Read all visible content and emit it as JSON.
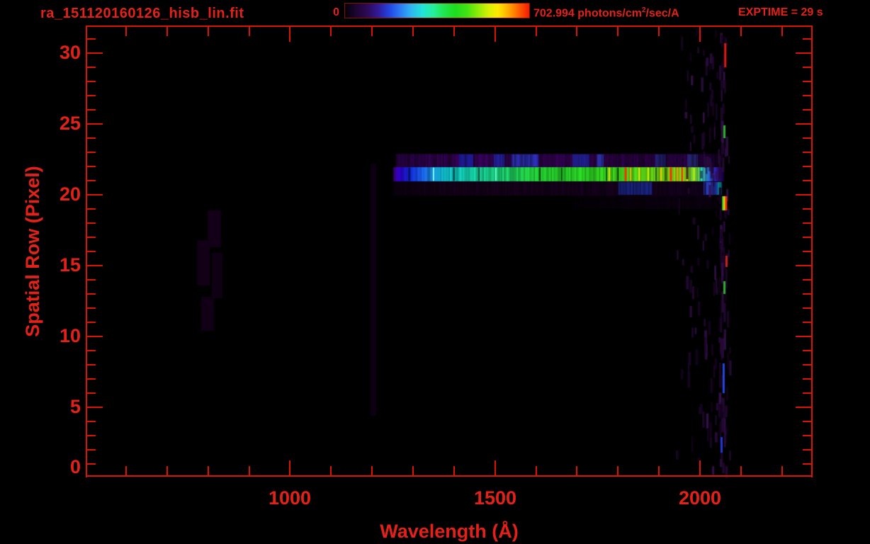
{
  "header": {
    "title": "ra_151120160126_hisb_lin.fit",
    "colorbar_min_label": "0",
    "flux_label_prefix": "702.994 photons/cm",
    "flux_label_sup": "2",
    "flux_label_suffix": "/sec/A",
    "exptime_label": "EXPTIME = 29 s"
  },
  "colors": {
    "text_red": "#e42118",
    "axis_red": "#da1404",
    "background": "#000000"
  },
  "chart_data": {
    "type": "heatmap",
    "title": "ra_151120160126_hisb_lin.fit",
    "xlabel": "Wavelength (Å)",
    "ylabel": "Spatial Row (Pixel)",
    "x_range": [
      503,
      2275
    ],
    "y_range": [
      0,
      31.8
    ],
    "x_major_ticks": [
      1000,
      1500,
      2000
    ],
    "x_minor_step": 100,
    "x_minor_first": 600,
    "x_minor_last": 2200,
    "y_major_ticks": [
      0,
      5,
      10,
      15,
      20,
      25,
      30
    ],
    "y_minor_step": 1,
    "grid": false,
    "colorbar": {
      "min": 0,
      "max": 702.994,
      "units": "photons/cm^2/sec/A",
      "gradient": [
        [
          0,
          "#050008"
        ],
        [
          0.06,
          "#1c0630"
        ],
        [
          0.12,
          "#2c0a54"
        ],
        [
          0.18,
          "#321a9a"
        ],
        [
          0.24,
          "#2244e0"
        ],
        [
          0.3,
          "#2b7bf4"
        ],
        [
          0.36,
          "#2fb6f0"
        ],
        [
          0.42,
          "#22e3d8"
        ],
        [
          0.48,
          "#25ef9a"
        ],
        [
          0.54,
          "#1fe64b"
        ],
        [
          0.6,
          "#1ddd1d"
        ],
        [
          0.66,
          "#3fe312"
        ],
        [
          0.72,
          "#8aec08"
        ],
        [
          0.78,
          "#d8f004"
        ],
        [
          0.83,
          "#fee800"
        ],
        [
          0.88,
          "#ffb400"
        ],
        [
          0.93,
          "#ff7000"
        ],
        [
          1,
          "#f51a02"
        ]
      ]
    },
    "exptime_s": 29,
    "trace": {
      "bands": [
        {
          "name": "row-19-faint",
          "rows": [
            19.0,
            19.95
          ],
          "lambda": [
            1690,
            2056
          ],
          "alphaStripe": 0.5,
          "stops": [
            [
              0,
              "#050007"
            ],
            [
              0.5,
              "#0b0010"
            ],
            [
              0.9,
              "#0e0014"
            ],
            [
              1,
              "#060008"
            ]
          ]
        },
        {
          "name": "row-20-lower",
          "rows": [
            19.95,
            20.95
          ],
          "lambda": [
            1252,
            2057
          ],
          "alphaStripe": 0.5,
          "stops": [
            [
              0,
              "#0d0011"
            ],
            [
              0.15,
              "#16001c"
            ],
            [
              0.5,
              "#190220"
            ],
            [
              0.8,
              "#17031f"
            ],
            [
              0.94,
              "#140120"
            ],
            [
              1,
              "#0a0010"
            ]
          ]
        },
        {
          "name": "row-21-main",
          "rows": [
            20.95,
            21.95
          ],
          "lambda": [
            1252,
            2059
          ],
          "alphaStripe": 0.32,
          "stops": [
            [
              0,
              "#4a0090"
            ],
            [
              0.02,
              "#3000d8"
            ],
            [
              0.05,
              "#1430f8"
            ],
            [
              0.1,
              "#1e7cf8"
            ],
            [
              0.15,
              "#12cfe4"
            ],
            [
              0.22,
              "#16e4c2"
            ],
            [
              0.3,
              "#1ce690"
            ],
            [
              0.38,
              "#24e258"
            ],
            [
              0.45,
              "#28de34"
            ],
            [
              0.6,
              "#30e424"
            ],
            [
              0.72,
              "#52e81c"
            ],
            [
              0.82,
              "#7eea14"
            ],
            [
              0.88,
              "#9ae412"
            ],
            [
              0.925,
              "#62d855"
            ],
            [
              0.945,
              "#2f9ad8"
            ],
            [
              0.96,
              "#2b55e8"
            ],
            [
              0.975,
              "#3518b0"
            ],
            [
              0.99,
              "#280668"
            ],
            [
              1,
              "#12002a"
            ]
          ]
        },
        {
          "name": "row-22-upper",
          "rows": [
            21.95,
            22.88
          ],
          "lambda": [
            1258,
            2052
          ],
          "alphaStripe": 0.5,
          "stops": [
            [
              0,
              "#26013f"
            ],
            [
              0.1,
              "#330156"
            ],
            [
              0.3,
              "#3a0260"
            ],
            [
              0.5,
              "#360259"
            ],
            [
              0.7,
              "#32024f"
            ],
            [
              0.9,
              "#2b0247"
            ],
            [
              0.97,
              "#1c0133"
            ],
            [
              1,
              "#0e0018"
            ]
          ]
        }
      ],
      "patches": [
        {
          "rows": [
            21.98,
            22.86
          ],
          "lambda": [
            1412,
            1447
          ],
          "color": "#2222b6"
        },
        {
          "rows": [
            21.98,
            22.86
          ],
          "lambda": [
            1497,
            1523
          ],
          "color": "#2a2cc4"
        },
        {
          "rows": [
            21.98,
            22.86
          ],
          "lambda": [
            1540,
            1606
          ],
          "color": "#3136cc"
        },
        {
          "rows": [
            21.98,
            22.86
          ],
          "lambda": [
            1689,
            1730
          ],
          "color": "#282ab8"
        },
        {
          "rows": [
            21.98,
            22.86
          ],
          "lambda": [
            1749,
            1765
          ],
          "color": "#3340cc"
        },
        {
          "rows": [
            21.98,
            22.86
          ],
          "lambda": [
            1891,
            1917
          ],
          "color": "#26267e"
        },
        {
          "rows": [
            21.98,
            22.86
          ],
          "lambda": [
            1969,
            1995
          ],
          "color": "#2c2c86"
        },
        {
          "rows": [
            20.0,
            20.9
          ],
          "lambda": [
            1801,
            1883
          ],
          "color": "#1e2a96"
        },
        {
          "rows": [
            20.0,
            20.9
          ],
          "lambda": [
            2009,
            2043
          ],
          "color": "#2d49e8"
        },
        {
          "rows": [
            20.0,
            20.9
          ],
          "lambda": [
            2043,
            2053
          ],
          "color": "#00b4c4"
        }
      ],
      "bright_lines_row": [
        20.98,
        21.92
      ],
      "bright_lines": [
        {
          "lambda": 1350,
          "color": "#7dffff",
          "w": 2
        },
        {
          "lambda": 1502,
          "color": "#5fffd0",
          "w": 2
        },
        {
          "lambda": 1779,
          "color": "#ffd000",
          "w": 2
        },
        {
          "lambda": 1819,
          "color": "#ff3000",
          "w": 3
        },
        {
          "lambda": 1831,
          "color": "#ffb000",
          "w": 2
        },
        {
          "lambda": 1852,
          "color": "#ffe000",
          "w": 2
        },
        {
          "lambda": 1874,
          "color": "#d8f000",
          "w": 2
        },
        {
          "lambda": 1905,
          "color": "#ffc800",
          "w": 2
        },
        {
          "lambda": 1929,
          "color": "#ff2800",
          "w": 3
        },
        {
          "lambda": 1945,
          "color": "#ff9800",
          "w": 2
        },
        {
          "lambda": 1957,
          "color": "#ff3000",
          "w": 2
        },
        {
          "lambda": 1969,
          "color": "#ffd800",
          "w": 2
        },
        {
          "lambda": 1986,
          "color": "#c8f000",
          "w": 2
        },
        {
          "lambda": 2004,
          "color": "#00e8ff",
          "w": 2
        }
      ],
      "dark_lines": [
        {
          "lambda": 1291,
          "w": 3
        },
        {
          "lambda": 1400,
          "w": 3
        },
        {
          "lambda": 1461,
          "w": 2
        },
        {
          "lambda": 1609,
          "w": 3
        },
        {
          "lambda": 1663,
          "w": 2
        },
        {
          "lambda": 1772,
          "w": 2
        },
        {
          "lambda": 1800,
          "w": 3
        },
        {
          "lambda": 1893,
          "w": 2
        },
        {
          "lambda": 1917,
          "w": 3
        }
      ],
      "specks": [
        {
          "lambda": 2061,
          "rows": [
            29.0,
            30.7
          ],
          "color": "#dc1810"
        },
        {
          "lambda": 2059,
          "rows": [
            24.0,
            24.9
          ],
          "color": "#28b428"
        },
        {
          "lambda": 2064,
          "rows": [
            14.9,
            15.7
          ],
          "color": "#c42418"
        },
        {
          "lambda": 2059,
          "rows": [
            13.0,
            13.9
          ],
          "color": "#2eae2e"
        },
        {
          "lambda": 2057,
          "rows": [
            6.0,
            8.1
          ],
          "color": "#2545de"
        },
        {
          "lambda": 2052,
          "rows": [
            1.8,
            2.9
          ],
          "color": "#2038d0"
        },
        {
          "lambda": 2056,
          "rows": [
            18.9,
            19.9
          ],
          "color": "#58d820"
        },
        {
          "lambda": 2060,
          "rows": [
            18.9,
            19.9
          ],
          "color": "#f0d800"
        },
        {
          "lambda": 2063,
          "rows": [
            18.9,
            19.9
          ],
          "color": "#e83010"
        }
      ],
      "artifacts": [
        {
          "lambda": [
            1196,
            1210
          ],
          "rows": [
            4.4,
            22.2
          ],
          "color": "#0c0012"
        },
        {
          "lambda": [
            799,
            831
          ],
          "rows": [
            16.3,
            18.9
          ],
          "color": "#130018"
        },
        {
          "lambda": [
            773,
            804
          ],
          "rows": [
            13.6,
            16.8
          ],
          "color": "#110016"
        },
        {
          "lambda": [
            809,
            835
          ],
          "rows": [
            12.7,
            15.9
          ],
          "color": "#0f0013"
        },
        {
          "lambda": [
            783,
            814
          ],
          "rows": [
            10.4,
            12.8
          ],
          "color": "#110015"
        }
      ],
      "noise": {
        "seed": 1337,
        "lambda": [
          1933,
          2072
        ],
        "rows": [
          0.4,
          31.5
        ],
        "count": 150,
        "skew": 0.5,
        "colors": [
          "#1b0526",
          "#230832",
          "#2b0b3e",
          "#170322",
          "#331048"
        ],
        "dense_column": {
          "lambda": [
            2046,
            2064
          ],
          "count": 48
        }
      }
    }
  }
}
